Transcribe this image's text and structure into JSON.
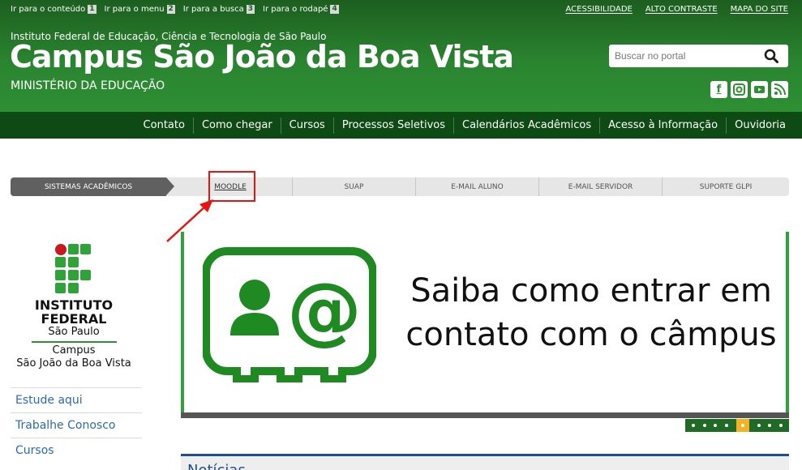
{
  "header": {
    "skip_links": [
      {
        "label": "Ir para o conteúdo",
        "key": "1"
      },
      {
        "label": "Ir para o menu",
        "key": "2"
      },
      {
        "label": "Ir para a busca",
        "key": "3"
      },
      {
        "label": "Ir para o rodapé",
        "key": "4"
      }
    ],
    "top_links": [
      "ACESSIBILIDADE",
      "ALTO CONTRASTE",
      "MAPA DO SITE"
    ],
    "institution": "Instituto Federal de Educação, Ciência e Tecnologia de São Paulo",
    "campus_title": "Campus São João da Boa Vista",
    "ministry": "MINISTÉRIO DA EDUCAÇÃO",
    "search": {
      "placeholder": "Buscar no portal",
      "value": ""
    },
    "social": [
      {
        "icon": "facebook-icon",
        "glyph": "f"
      },
      {
        "icon": "instagram-icon",
        "glyph": "◎"
      },
      {
        "icon": "youtube-icon",
        "glyph": "▶"
      },
      {
        "icon": "rss-icon",
        "glyph": "≋"
      }
    ]
  },
  "main_nav": [
    "Contato",
    "Como chegar",
    "Cursos",
    "Processos Seletivos",
    "Calendários Acadêmicos",
    "Acesso à Informação",
    "Ouvidoria"
  ],
  "systems_bar": {
    "label": "SISTEMAS ACADÊMICOS",
    "links": [
      "MOODLE",
      "SUAP",
      "E-MAIL ALUNO",
      "E-MAIL SERVIDOR",
      "SUPORTE GLPI"
    ]
  },
  "sidebar": {
    "logo": {
      "line1": "INSTITUTO",
      "line2": "FEDERAL",
      "line3": "São Paulo",
      "line4": "Campus",
      "line5": "São João da Boa Vista"
    },
    "menu": [
      "Estude aqui",
      "Trabalhe Conosco",
      "Cursos"
    ]
  },
  "banner": {
    "line1": "Saiba como entrar em",
    "line2": "contato com o câmpus",
    "slide_count": 8,
    "active_slide": 5
  },
  "news": {
    "title": "Notícias"
  },
  "colors": {
    "header_green": "#2e8f33",
    "nav_dark_green": "#0e4a13",
    "link_blue": "#2c6ab0",
    "highlight_red": "#e8140f",
    "slider_active": "#f0b325"
  }
}
